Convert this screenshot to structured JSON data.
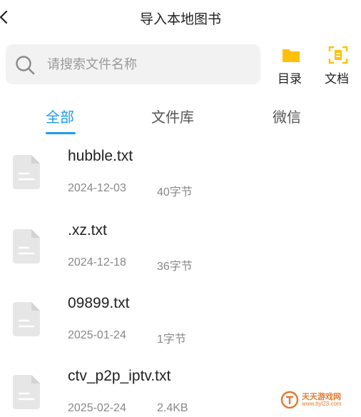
{
  "header": {
    "title": "导入本地图书"
  },
  "search": {
    "placeholder": "请搜索文件名称",
    "value": ""
  },
  "tools": [
    {
      "label": "目录",
      "icon": "folder-icon",
      "color": "#ffc107"
    },
    {
      "label": "文档",
      "icon": "scan-document-icon",
      "color": "#ffc107"
    }
  ],
  "tabs": [
    {
      "label": "全部",
      "active": true
    },
    {
      "label": "文件库",
      "active": false
    },
    {
      "label": "微信",
      "active": false
    }
  ],
  "colors": {
    "accent": "#1e9bf0",
    "file_icon": "#e6e6e6",
    "secondary_text": "#888888"
  },
  "files": [
    {
      "name": "hubble.txt",
      "date": "2024-12-03",
      "size": "40字节"
    },
    {
      "name": ".xz.txt",
      "date": "2024-12-18",
      "size": "36字节"
    },
    {
      "name": "09899.txt",
      "date": "2025-01-24",
      "size": "1字节"
    },
    {
      "name": "ctv_p2p_iptv.txt",
      "date": "2025-02-24",
      "size": "2.4KB"
    }
  ],
  "watermark": {
    "text": "天天游戏网",
    "sub": "www.ttyl23.com"
  }
}
